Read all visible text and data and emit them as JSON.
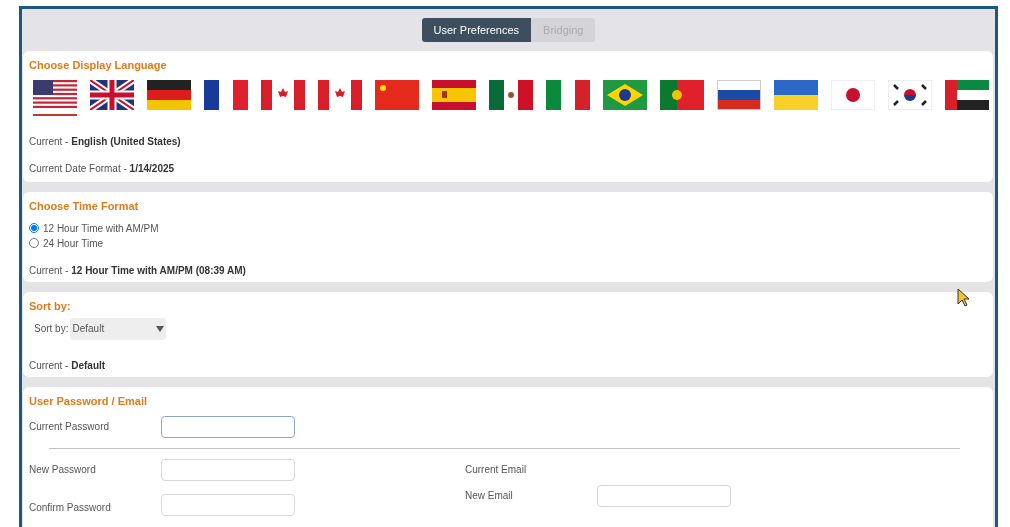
{
  "tabs": [
    {
      "label": "User Preferences",
      "selected": true
    },
    {
      "label": "Bridging",
      "selected": false
    }
  ],
  "language": {
    "title": "Choose Display Language",
    "flags": [
      {
        "kind": "us",
        "selected": true
      },
      {
        "kind": "uk",
        "selected": false
      },
      {
        "kind": "de",
        "selected": false
      },
      {
        "kind": "fr",
        "selected": false
      },
      {
        "kind": "ca",
        "selected": false
      },
      {
        "kind": "ca",
        "selected": false
      },
      {
        "kind": "cn",
        "selected": false
      },
      {
        "kind": "es",
        "selected": false
      },
      {
        "kind": "mx",
        "selected": false
      },
      {
        "kind": "it",
        "selected": false
      },
      {
        "kind": "br",
        "selected": false
      },
      {
        "kind": "pt",
        "selected": false
      },
      {
        "kind": "ru",
        "selected": false
      },
      {
        "kind": "ua",
        "selected": false
      },
      {
        "kind": "jp",
        "selected": false
      },
      {
        "kind": "kr",
        "selected": false
      },
      {
        "kind": "ae",
        "selected": false
      }
    ],
    "current_label": "Current -",
    "current_value": "English (United States)",
    "date_label": "Current Date Format -",
    "date_value": "1/14/2025"
  },
  "time": {
    "title": "Choose Time Format",
    "options": [
      {
        "label": "12 Hour Time with AM/PM",
        "selected": true
      },
      {
        "label": "24 Hour Time",
        "selected": false
      }
    ],
    "current_label": "Current -",
    "current_value": "12 Hour Time with AM/PM (08:39 AM)"
  },
  "sort": {
    "title": "Sort by:",
    "label": "Sort by:",
    "value": "Default",
    "current_label": "Current -",
    "current_value": "Default"
  },
  "account": {
    "title": "User Password / Email",
    "current_password": "Current Password",
    "new_password": "New Password",
    "confirm_password": "Confirm Password",
    "current_email": "Current Email",
    "new_email": "New Email"
  }
}
